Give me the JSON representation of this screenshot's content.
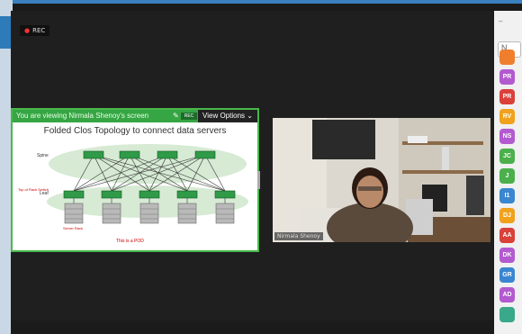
{
  "recording": {
    "label": "REC"
  },
  "share": {
    "banner": "You are viewing Nirmala Shenoy's screen",
    "rec_badge": "REC",
    "view_options": "View Options ⌄"
  },
  "slide": {
    "title": "Folded Clos Topology to connect data servers",
    "spine_label": "Spine",
    "leaf_label": "Leaf",
    "tor_label": "Top of Rack\nSwitch",
    "server_label": "Server Rack",
    "pod_label": "This is a POD"
  },
  "video": {
    "name": "Nirmala Shenoy"
  },
  "participants_panel": {
    "search_placeholder": "N",
    "avatars": [
      {
        "initials": "",
        "color": "#f07f2d"
      },
      {
        "initials": "PR",
        "color": "#b35ad0"
      },
      {
        "initials": "PR",
        "color": "#d9413a"
      },
      {
        "initials": "RV",
        "color": "#f0a21c"
      },
      {
        "initials": "NS",
        "color": "#b35ad0"
      },
      {
        "initials": "JC",
        "color": "#4bb04c"
      },
      {
        "initials": "J",
        "color": "#4bb04c"
      },
      {
        "initials": "I1",
        "color": "#3a86d0"
      },
      {
        "initials": "DJ",
        "color": "#f0a21c"
      },
      {
        "initials": "AA",
        "color": "#d9413a"
      },
      {
        "initials": "DK",
        "color": "#b35ad0"
      },
      {
        "initials": "GR",
        "color": "#3a86d0"
      },
      {
        "initials": "AD",
        "color": "#b35ad0"
      },
      {
        "initials": "",
        "color": "#3aa88a"
      }
    ]
  }
}
